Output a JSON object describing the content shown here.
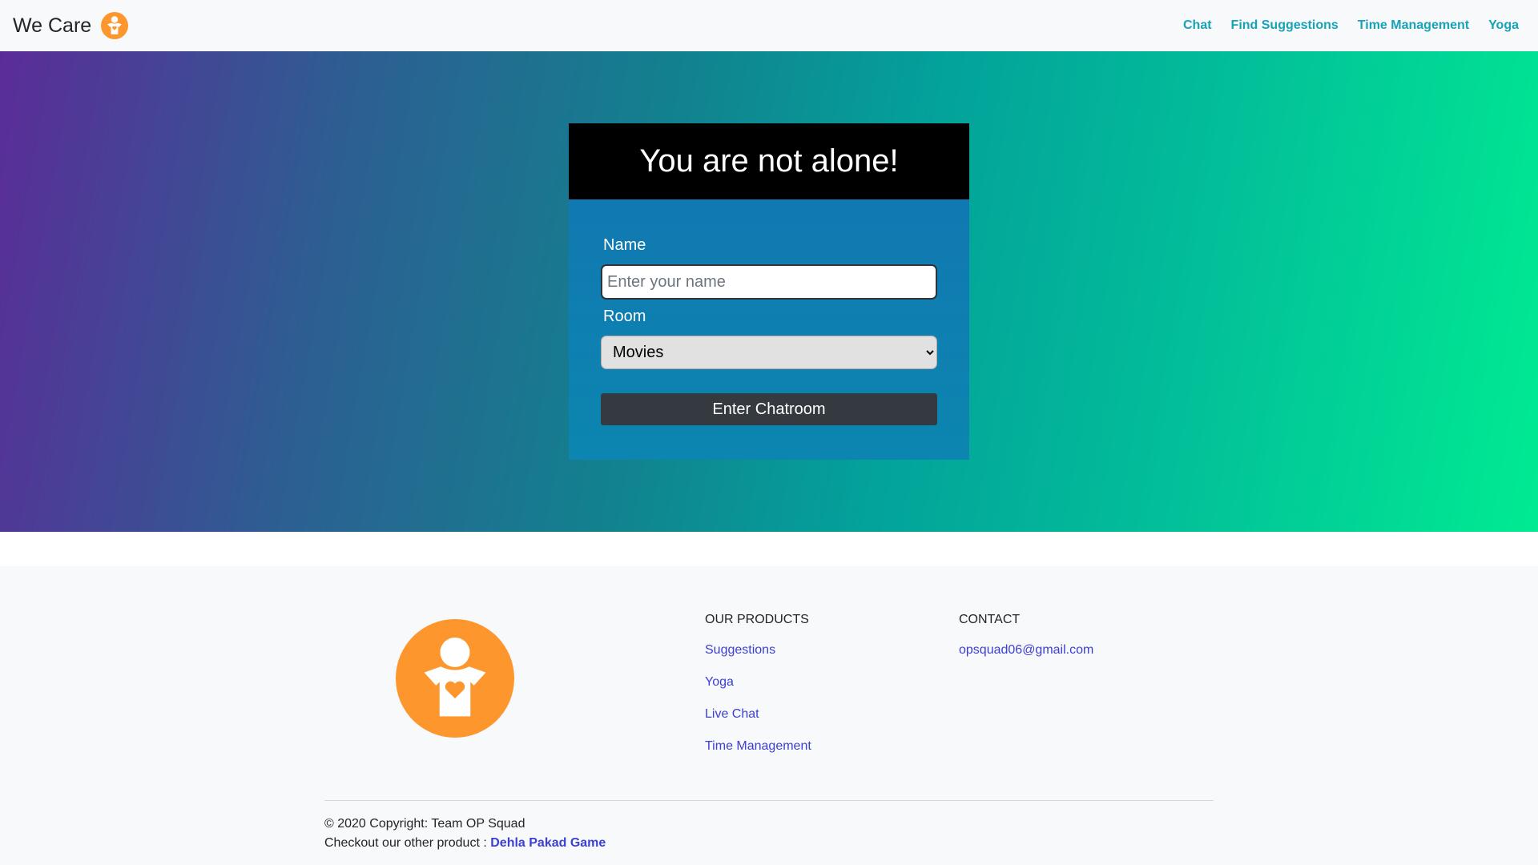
{
  "navbar": {
    "brand": "We Care",
    "links": [
      "Chat",
      "Find Suggestions",
      "Time Management",
      "Yoga"
    ]
  },
  "hero": {
    "title": "You are not alone!",
    "name_label": "Name",
    "name_placeholder": "Enter your name",
    "name_value": "",
    "room_label": "Room",
    "room_selected": "Movies",
    "enter_button": "Enter Chatroom"
  },
  "footer": {
    "products_heading": "OUR PRODUCTS",
    "products": [
      "Suggestions",
      "Yoga",
      "Live Chat",
      "Time Management"
    ],
    "contact_heading": "CONTACT",
    "contact_email": "opsquad06@gmail.com",
    "copyright": "© 2020 Copyright: Team OP Squad",
    "other_product_prefix": "Checkout our other product : ",
    "other_product_link": "Dehla Pakad Game"
  },
  "colors": {
    "logo_orange": "#fd962d",
    "nav_link": "#17a2b8",
    "footer_link": "#3b3fd4",
    "button_dark": "#343a40"
  },
  "icons": {
    "brand_logo": "person-heart-icon",
    "footer_logo": "person-heart-icon",
    "select_arrow": "chevron-down-icon"
  }
}
